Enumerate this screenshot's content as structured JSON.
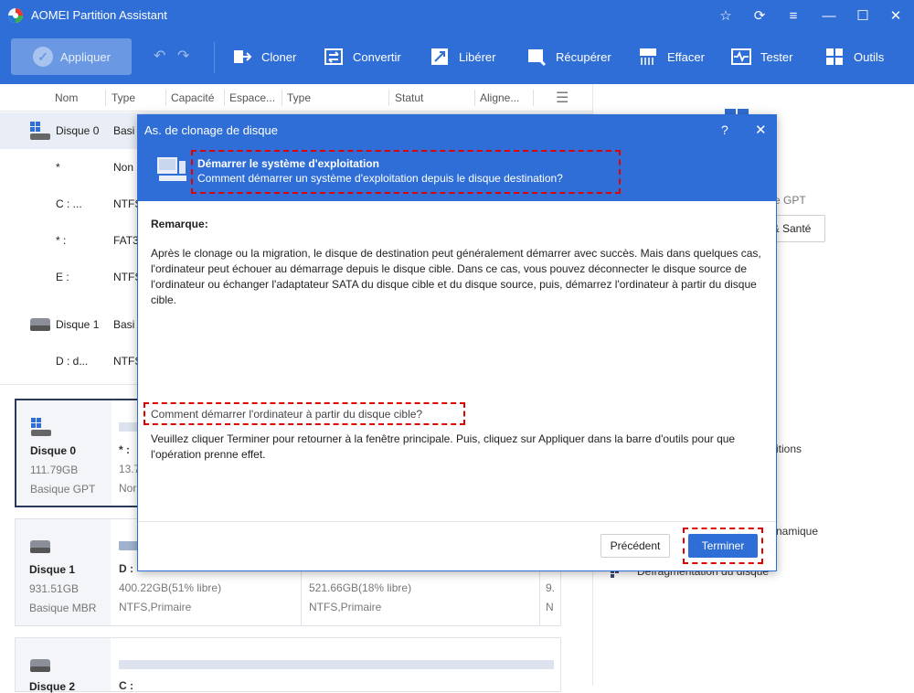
{
  "window": {
    "title": "AOMEI Partition Assistant"
  },
  "toolbar": {
    "apply": "Appliquer",
    "tools": [
      "Cloner",
      "Convertir",
      "Libérer",
      "Récupérer",
      "Effacer",
      "Tester",
      "Outils"
    ]
  },
  "table": {
    "headers": [
      "Nom",
      "Type",
      "Capacité",
      "Espace...",
      "Type",
      "Statut",
      "Aligne..."
    ],
    "rows": [
      {
        "name": "Disque 0",
        "type": "Basi"
      },
      {
        "name": "*",
        "type": "Non"
      },
      {
        "name": "C : ...",
        "type": "NTFS"
      },
      {
        "name": "* :",
        "type": "FAT3"
      },
      {
        "name": "E :",
        "type": "NTFS"
      },
      {
        "name": "Disque 1",
        "type": "Basi"
      },
      {
        "name": "D : d...",
        "type": "NTFS"
      }
    ]
  },
  "cards": [
    {
      "name": "Disque 0",
      "size": "111.79GB",
      "kind": "Basique GPT",
      "p1_label": "* :",
      "p1_size": "13.7",
      "p1_fs": "Nor"
    },
    {
      "name": "Disque 1",
      "size": "931.51GB",
      "kind": "Basique MBR",
      "p1_label": "D :",
      "p1_size": "400.22GB(51% libre)",
      "p1_fs": "NTFS,Primaire",
      "p2_size": "521.66GB(18% libre)",
      "p2_fs": "NTFS,Primaire",
      "p3_size": "9.",
      "p3_fs": "N"
    },
    {
      "name": "Disque 2",
      "p1_label": "C :"
    }
  ],
  "rightpanel": {
    "gpt": "e GPT",
    "health": "& Santé",
    "partitions": "itions",
    "dynamic": "namique",
    "defrag": "Défragmentation du disque"
  },
  "dialog": {
    "title": "As. de clonage de disque",
    "help": "?",
    "header_title": "Démarrer le système d'exploitation",
    "header_sub": "Comment démarrer un système d'exploitation depuis le disque destination?",
    "remark_label": "Remarque:",
    "remark_text": "Après le clonage ou la migration, le disque de destination peut généralement démarrer avec succès. Mais dans quelques cas, l'ordinateur peut échouer au démarrage depuis le disque cible. Dans ce cas, vous pouvez déconnecter le disque source de l'ordinateur ou échanger l'adaptateur SATA du disque cible et du disque source, puis, démarrez l'ordinateur à partir du disque cible.",
    "link": "Comment démarrer l'ordinateur à partir du disque cible?",
    "instruction": "Veuillez cliquer Terminer pour retourner à la fenêtre principale. Puis, cliquez sur Appliquer dans la barre d'outils pour que l'opération prenne effet.",
    "back": "Précédent",
    "finish": "Terminer"
  },
  "colors": {
    "brand": "#2f6ed6",
    "highlight": "#e00000",
    "primary_button": "#2f6ed6"
  }
}
